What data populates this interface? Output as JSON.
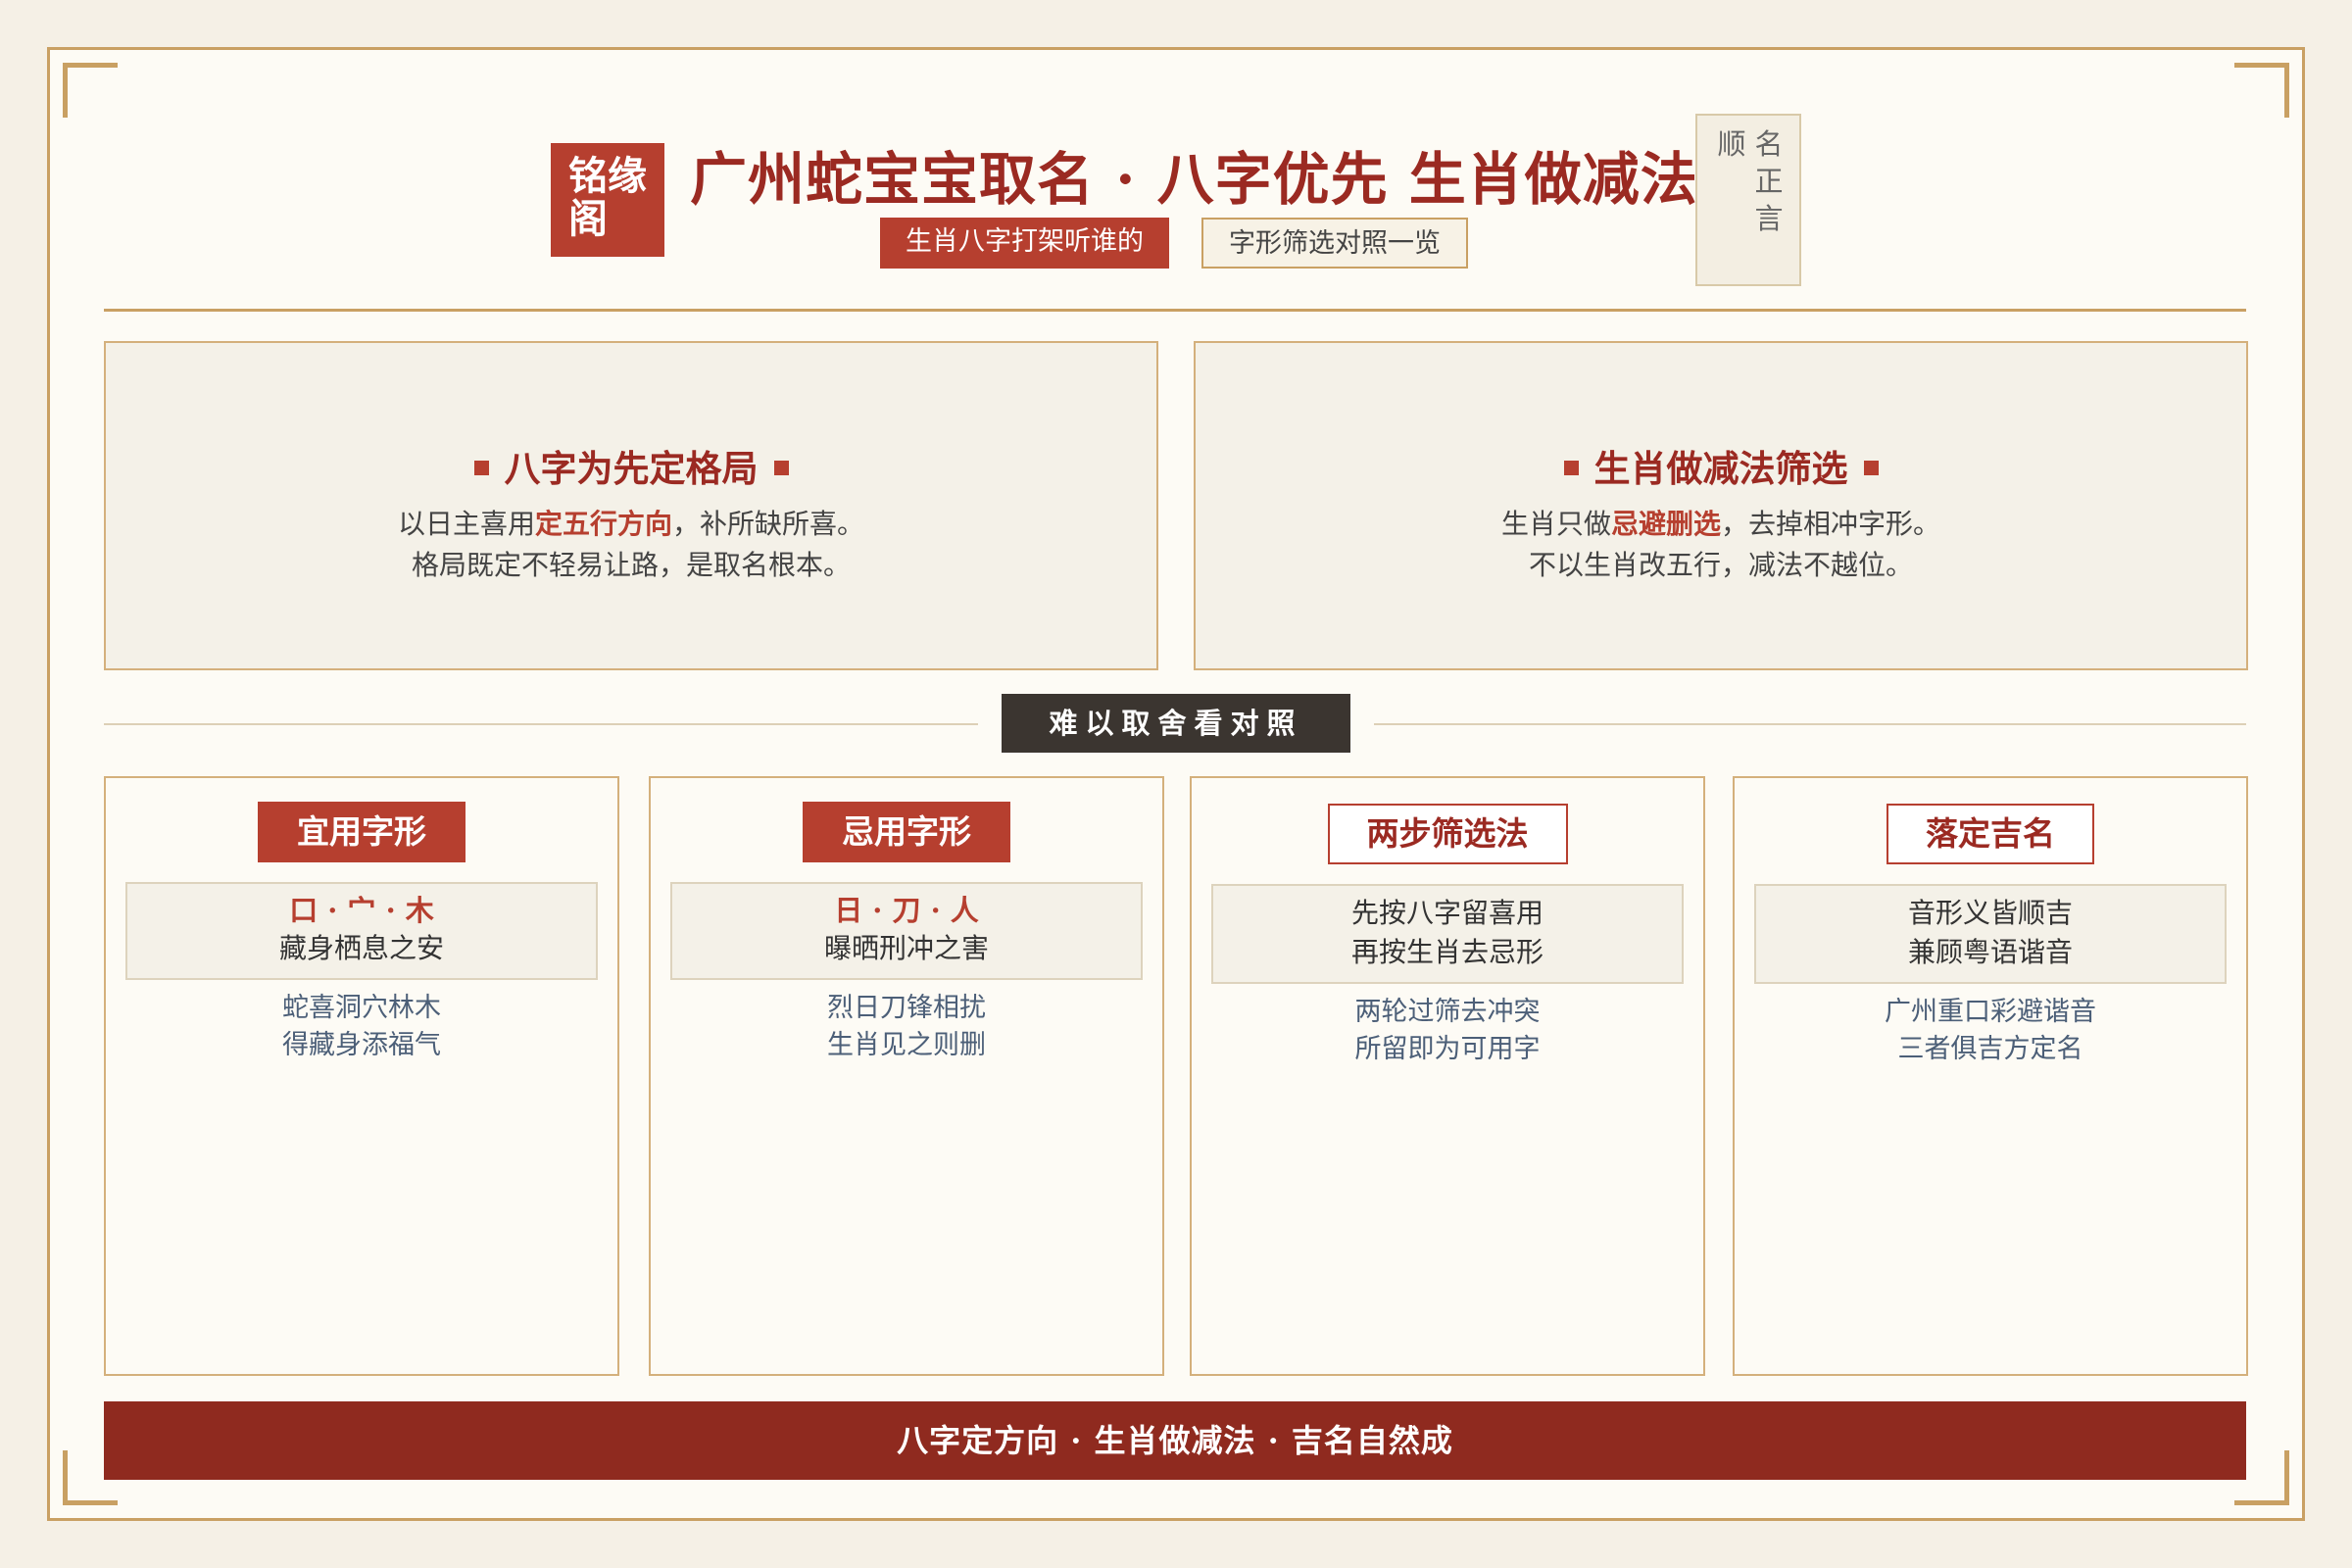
{
  "brand": {
    "logo_text": "铭缘阁"
  },
  "header": {
    "title": "广州蛇宝宝取名 · 八字优先 生肖做减法",
    "tag_primary": "生肖八字打架听谁的",
    "tag_secondary": "字形筛选对照一览"
  },
  "seal": {
    "col_1": "顺",
    "col_2": "名正言"
  },
  "panels": [
    {
      "heading": "八字为先定格局",
      "line1_pre": "以日主喜用",
      "line1_hl": "定五行方向",
      "line1_post": "，补所缺所喜。",
      "line2": "格局既定不轻易让路，是取名根本。"
    },
    {
      "heading": "生肖做减法筛选",
      "line1_pre": "生肖只做",
      "line1_hl": "忌避删选",
      "line1_post": "，去掉相冲字形。",
      "line2": "不以生肖改五行，减法不越位。"
    }
  ],
  "divider": {
    "label": "难以取舍看对照"
  },
  "cards": [
    {
      "title": "宜用字形",
      "box_red": "口 · 宀 · 木",
      "box_line1": "藏身栖息之安",
      "box_line2": "",
      "note1": "蛇喜洞穴林木",
      "note2": "得藏身添福气"
    },
    {
      "title": "忌用字形",
      "box_red": "日 · 刀 · 人",
      "box_line1": "曝晒刑冲之害",
      "box_line2": "",
      "note1": "烈日刀锋相扰",
      "note2": "生肖见之则删"
    },
    {
      "title": "两步筛选法",
      "box_red": "",
      "box_line1": "先按八字留喜用",
      "box_line2": "再按生肖去忌形",
      "note1": "两轮过筛去冲突",
      "note2": "所留即为可用字"
    },
    {
      "title": "落定吉名",
      "box_red": "",
      "box_line1": "音形义皆顺吉",
      "box_line2": "兼顾粤语谐音",
      "note1": "广州重口彩避谐音",
      "note2": "三者俱吉方定名"
    }
  ],
  "footer": {
    "text": "八字定方向 · 生肖做减法 · 吉名自然成"
  },
  "colors": {
    "accent_red": "#b63f2f",
    "dark_red": "#8f2a1f",
    "gold": "#c9a063",
    "paper": "#fdfbf5"
  }
}
